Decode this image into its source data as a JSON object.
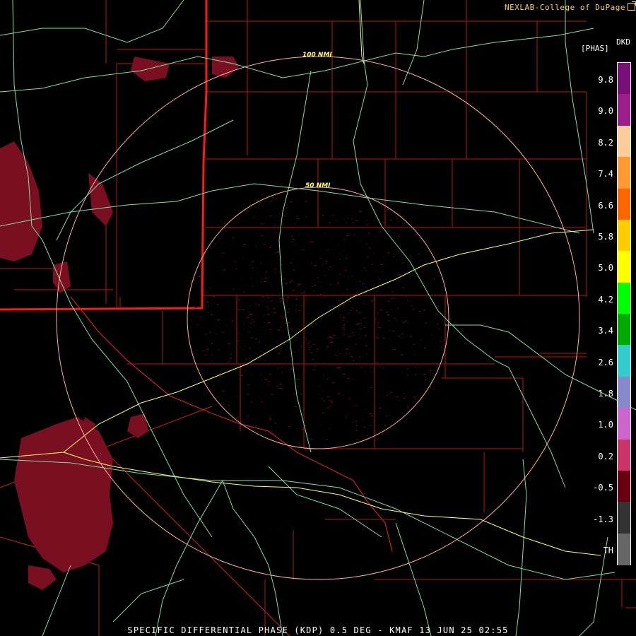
{
  "header": {
    "credit": "NEXLAB-College of DuPage"
  },
  "product": {
    "code": "DKD",
    "units": "[PHAS]"
  },
  "footer": {
    "caption": "SPECIFIC DIFFERENTIAL PHASE (KDP) 0.5 DEG - KMAF 13 JUN 25 02:55"
  },
  "range_rings": [
    {
      "label": "100 NMI"
    },
    {
      "label": "50 NMI"
    }
  ],
  "legend": {
    "ticks": [
      "9.8",
      "9.0",
      "8.2",
      "7.4",
      "6.6",
      "5.8",
      "5.0",
      "4.2",
      "3.4",
      "2.6",
      "1.8",
      "1.0",
      "0.2",
      "-0.5",
      "-1.3",
      "TH"
    ],
    "colors": [
      "#7a0f7a",
      "#9a1f8a",
      "#ffcc99",
      "#ff9933",
      "#ff6600",
      "#ffcc00",
      "#ffff00",
      "#00ff00",
      "#00aa00",
      "#33cccc",
      "#8888cc",
      "#cc66cc",
      "#cc3366",
      "#660011",
      "#333333",
      "#666666"
    ]
  },
  "colors": {
    "state_border": "#ff1a1a",
    "county_lines": "#b81414",
    "highways": "#7fe0a0",
    "interstates": "#ffff66",
    "range_rings": "#ffb0a0",
    "echo": "#7a0f22"
  }
}
